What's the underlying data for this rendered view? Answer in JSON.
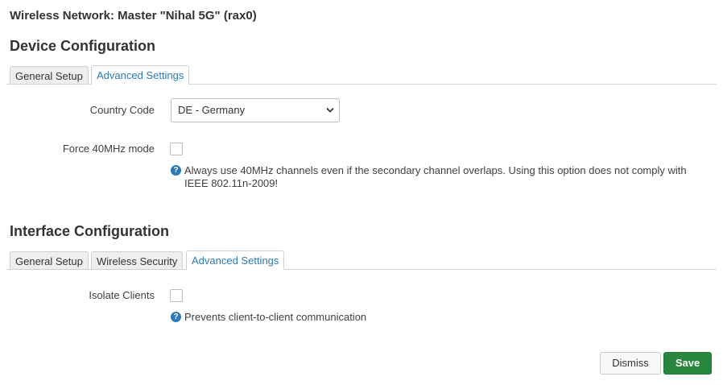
{
  "window_title": "Wireless Network: Master \"Nihal 5G\" (rax0)",
  "device_config": {
    "title": "Device Configuration",
    "tabs": [
      {
        "label": "General Setup",
        "active": false
      },
      {
        "label": "Advanced Settings",
        "active": true
      }
    ],
    "country_code": {
      "label": "Country Code",
      "value": "DE - Germany"
    },
    "force_40mhz": {
      "label": "Force 40MHz mode",
      "checked": false,
      "help_line1": "Always use 40MHz channels even if the secondary channel overlaps. Using this option does not comply with",
      "help_line2": "IEEE 802.11n-2009!"
    }
  },
  "interface_config": {
    "title": "Interface Configuration",
    "tabs": [
      {
        "label": "General Setup",
        "active": false
      },
      {
        "label": "Wireless Security",
        "active": false
      },
      {
        "label": "Advanced Settings",
        "active": true
      }
    ],
    "isolate_clients": {
      "label": "Isolate Clients",
      "checked": false,
      "help": "Prevents client-to-client communication"
    }
  },
  "footer": {
    "dismiss_label": "Dismiss",
    "save_label": "Save"
  },
  "colors": {
    "accent": "#2a7ab8",
    "save_green": "#28873c"
  }
}
